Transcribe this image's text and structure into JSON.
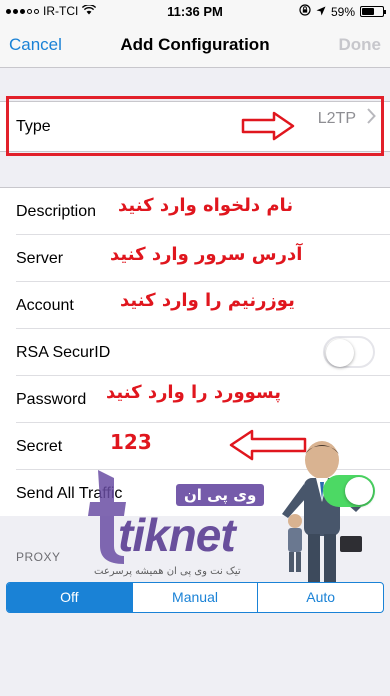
{
  "status_bar": {
    "carrier": "IR-TCI",
    "time": "11:36 PM",
    "battery": "59%",
    "battery_level": 0.59,
    "icons": [
      "signal-dots-icon",
      "wifi-icon",
      "orientation-lock-icon",
      "location-arrow-icon",
      "battery-icon"
    ]
  },
  "nav": {
    "cancel_label": "Cancel",
    "title": "Add Configuration",
    "done_label": "Done"
  },
  "type_row": {
    "label": "Type",
    "value": "L2TP"
  },
  "fields": {
    "description_label": "Description",
    "server_label": "Server",
    "account_label": "Account",
    "rsa_label": "RSA SecurID",
    "password_label": "Password",
    "secret_label": "Secret",
    "send_all_label": "Send All Traffic"
  },
  "toggles": {
    "rsa_securid": false,
    "send_all_traffic": true
  },
  "annotations": {
    "description": "نام دلخواه وارد کنید",
    "server": "آدرس سرور وارد کنید",
    "account": "یوزرنیم را وارد کنید",
    "password": "پسوورد را وارد کنید",
    "secret": "123"
  },
  "proxy": {
    "header": "PROXY",
    "options": [
      "Off",
      "Manual",
      "Auto"
    ],
    "selected": "Off"
  },
  "watermark": {
    "brand": "tiknet",
    "badge": "وی پی ان",
    "tagline": "تیک نت وی پی ان همیشه پرسرعت"
  },
  "colors": {
    "accent": "#1a82d6",
    "annotation_red": "#e0161e",
    "toggle_on": "#4cd964",
    "background": "#efeff4"
  }
}
